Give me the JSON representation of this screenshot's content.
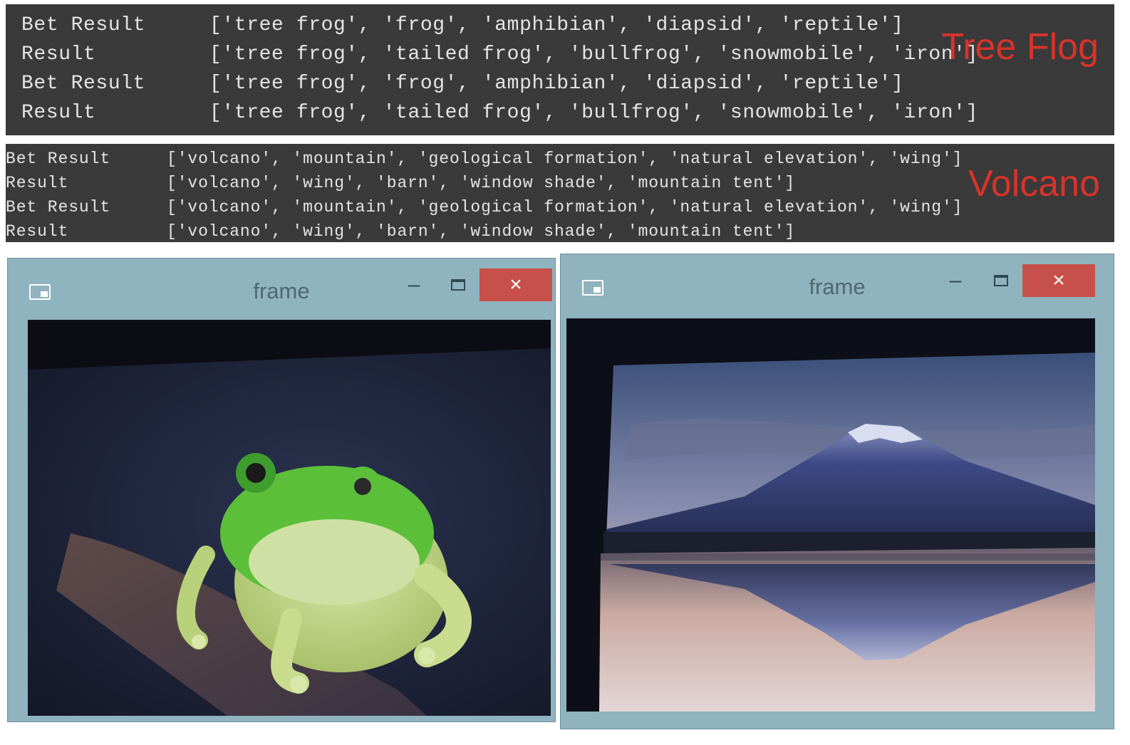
{
  "console_frog": {
    "lines": [
      {
        "label": "Bet Result",
        "value": "['tree frog', 'frog', 'amphibian', 'diapsid', 'reptile']"
      },
      {
        "label": "Result",
        "value": "['tree frog', 'tailed frog', 'bullfrog', 'snowmobile', 'iron']"
      },
      {
        "label": "Bet Result",
        "value": "['tree frog', 'frog', 'amphibian', 'diapsid', 'reptile']"
      },
      {
        "label": "Result",
        "value": "['tree frog', 'tailed frog', 'bullfrog', 'snowmobile', 'iron']"
      }
    ],
    "overlay_label": "Tree Flog"
  },
  "console_volcano": {
    "lines": [
      {
        "label": "Bet Result",
        "value": "['volcano', 'mountain', 'geological formation', 'natural elevation', 'wing']"
      },
      {
        "label": "Result",
        "value": "['volcano', 'wing', 'barn', 'window shade', 'mountain tent']"
      },
      {
        "label": "Bet Result",
        "value": "['volcano', 'mountain', 'geological formation', 'natural elevation', 'wing']"
      },
      {
        "label": "Result",
        "value": "['volcano', 'wing', 'barn', 'window shade', 'mountain tent']"
      }
    ],
    "overlay_label": "Volcano"
  },
  "windows": [
    {
      "title": "frame",
      "minimize_glyph": "–",
      "close_glyph": "×",
      "icon": "window-app-icon",
      "content": "tree-frog-camera-frame"
    },
    {
      "title": "frame",
      "minimize_glyph": "–",
      "close_glyph": "×",
      "icon": "window-app-icon",
      "content": "mount-fuji-camera-frame"
    }
  ],
  "colors": {
    "console_bg": "#3a3a3a",
    "console_text": "#e4e4e4",
    "overlay_red": "#d8332a",
    "window_frame": "#8fb3bf",
    "close_button": "#c7514a"
  }
}
